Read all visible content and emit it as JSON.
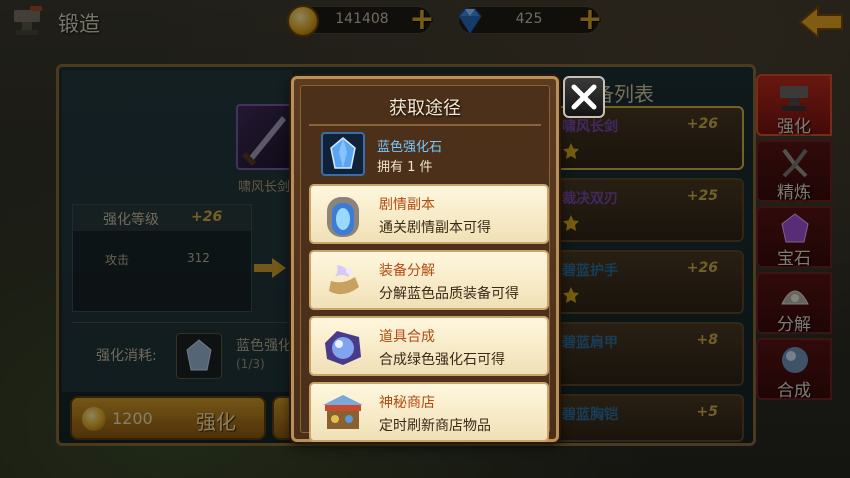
{
  "header": {
    "title": "锻造",
    "gold": "141408",
    "diamonds": "425",
    "icons": [
      "anvil-icon",
      "gold-coin-icon",
      "diamond-icon",
      "plus-icon",
      "back-arrow-icon"
    ]
  },
  "forge": {
    "item_name": "啸风长剑",
    "level_label": "强化等级",
    "level_value": "+26",
    "stat_name": "攻击",
    "stat_value": "312",
    "cost_label": "强化消耗:",
    "cost_item": "蓝色强化",
    "cost_count": "(1/3)",
    "enhance_cost": "1200",
    "enhance_label": "强化"
  },
  "equipment_list": {
    "title": "备列表",
    "items": [
      {
        "name": "啸风长剑",
        "level": "+26"
      },
      {
        "name": "裁决双刃",
        "level": "+25"
      },
      {
        "name": "碧蓝护手",
        "level": "+26"
      },
      {
        "name": "碧蓝肩甲",
        "level": "+8"
      },
      {
        "name": "碧蓝胸铠",
        "level": "+5"
      }
    ]
  },
  "side_tabs": [
    {
      "label": "强化",
      "icon": "anvil-icon",
      "active": true
    },
    {
      "label": "精炼",
      "icon": "tongs-icon",
      "active": false
    },
    {
      "label": "宝石",
      "icon": "gem-icon",
      "active": false
    },
    {
      "label": "分解",
      "icon": "shell-icon",
      "active": false
    },
    {
      "label": "合成",
      "icon": "crystal-orb-icon",
      "active": false
    }
  ],
  "modal": {
    "title": "获取途径",
    "item_name": "蓝色强化石",
    "owned": "拥有 1 件",
    "close_icon": "close-icon",
    "ways": [
      {
        "title": "剧情副本",
        "desc": "通关剧情副本可得",
        "icon": "portal-icon"
      },
      {
        "title": "装备分解",
        "desc": "分解蓝色品质装备可得",
        "icon": "magic-scroll-icon"
      },
      {
        "title": "道具合成",
        "desc": "合成绿色强化石可得",
        "icon": "crystal-orb-icon"
      },
      {
        "title": "神秘商店",
        "desc": "定时刷新商店物品",
        "icon": "shop-stall-icon"
      }
    ]
  },
  "colors": {
    "accent_gold": "#d0b04a",
    "blue_item": "#78c8ff",
    "way_title": "#b44a10",
    "tab_active": "#c02a1a"
  }
}
